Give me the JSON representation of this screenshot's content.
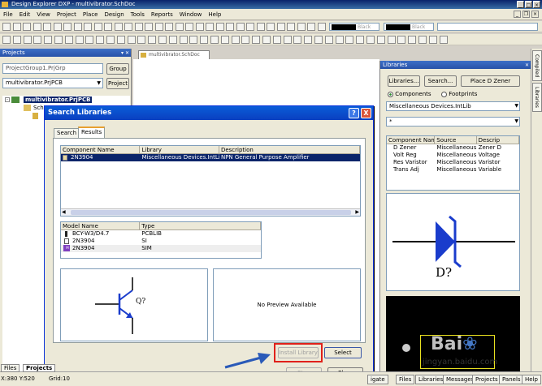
{
  "window": {
    "title": "Design Explorer DXP - multivibrator.SchDoc"
  },
  "menu": [
    "File",
    "Edit",
    "View",
    "Project",
    "Place",
    "Design",
    "Tools",
    "Reports",
    "Window",
    "Help"
  ],
  "toolbar": {
    "color_select_1": "Black",
    "color_select_2": "Black"
  },
  "projects_panel": {
    "title": "Projects",
    "workspace_field": "ProjectGroup1.PrjGrp",
    "group_button": "Group",
    "project_field": "multivibrator.PrjPCB",
    "project_button": "Project",
    "tree": [
      {
        "label": "multivibrator.PrjPCB",
        "selected": true
      },
      {
        "label": "Sch",
        "selected": false
      }
    ]
  },
  "document_tab": "multivibrator.SchDoc",
  "libraries_panel": {
    "title": "Libraries",
    "libraries_button": "Libraries...",
    "search_button": "Search...",
    "place_button": "Place D Zener",
    "radio_components": "Components",
    "radio_footprints": "Footprints",
    "library_select": "Miscellaneous Devices.IntLib",
    "filter": "*",
    "columns": [
      "Component Name",
      "Source",
      "Descrip"
    ],
    "rows": [
      [
        "D Zener",
        "Miscellaneous D",
        "Zener D"
      ],
      [
        "Volt Reg",
        "Miscellaneous D",
        "Voltage"
      ],
      [
        "Res Varistor",
        "Miscellaneous D",
        "Varistor"
      ],
      [
        "Trans Adj",
        "Miscellaneous D",
        "Variable"
      ]
    ],
    "symbol_label": "D?"
  },
  "side_tabs": [
    "Compiled",
    "Libraries"
  ],
  "dialog": {
    "title": "Search Libraries",
    "help_btn": "?",
    "close_btn": "X",
    "tabs": [
      "Search",
      "Results"
    ],
    "results_columns": [
      "Component Name",
      "Library",
      "Description"
    ],
    "results_rows": [
      [
        "2N3904",
        "Miscellaneous Devices.IntLib",
        "NPN General Purpose Amplifier"
      ]
    ],
    "model_columns": [
      "Model Name",
      "Type"
    ],
    "model_rows": [
      [
        "BCY-W3/D4.7",
        "PCBLIB"
      ],
      [
        "2N3904",
        "SI"
      ],
      [
        "2N3904",
        "SIM"
      ]
    ],
    "symbol_label": "Q?",
    "no_preview": "No Preview Available",
    "install_button": "Install Library",
    "select_button": "Select",
    "stop_button": "Stop",
    "close_button": "Close"
  },
  "status": {
    "coords": "X:380 Y:520",
    "grid": "Grid:10",
    "left_tabs": [
      "Files",
      "Projects"
    ],
    "right_tabs": [
      "igate",
      "Files",
      "Libraries",
      "Messages",
      "Projects",
      "Panels",
      "Help"
    ]
  },
  "watermark": {
    "site": "jingyan.baidu.com"
  }
}
